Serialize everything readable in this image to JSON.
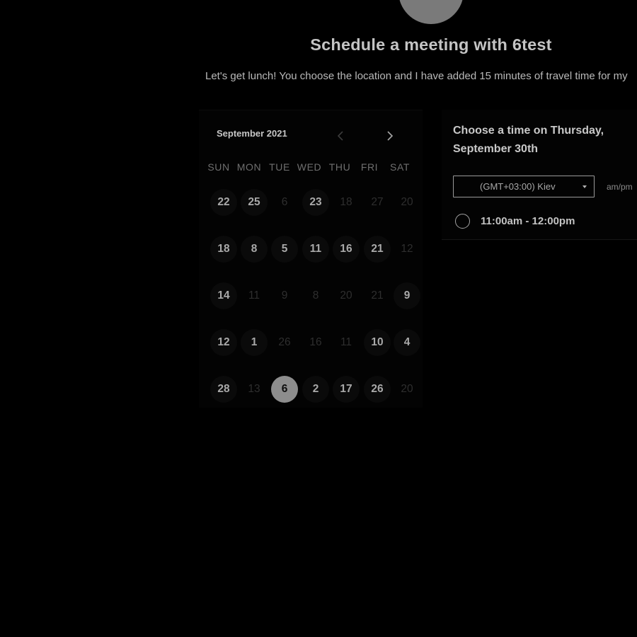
{
  "header": {
    "title": "Schedule a meeting with 6test",
    "description": "Let's get lunch! You choose the location and I have added 15 minutes of travel time for my"
  },
  "calendar": {
    "month_label": "September 2021",
    "prev_icon": "chevron-left-icon",
    "next_icon": "chevron-right-icon",
    "weekdays": [
      "SUN",
      "MON",
      "TUE",
      "WED",
      "THU",
      "FRI",
      "SAT"
    ],
    "weeks": [
      [
        {
          "label": "22",
          "state": "available"
        },
        {
          "label": "25",
          "state": "available"
        },
        {
          "label": "6",
          "state": "unavailable"
        },
        {
          "label": "23",
          "state": "available"
        },
        {
          "label": "18",
          "state": "unavailable"
        },
        {
          "label": "27",
          "state": "unavailable"
        },
        {
          "label": "20",
          "state": "unavailable"
        }
      ],
      [
        {
          "label": "18",
          "state": "available"
        },
        {
          "label": "8",
          "state": "available"
        },
        {
          "label": "5",
          "state": "available"
        },
        {
          "label": "11",
          "state": "available"
        },
        {
          "label": "16",
          "state": "available"
        },
        {
          "label": "21",
          "state": "available"
        },
        {
          "label": "12",
          "state": "unavailable"
        }
      ],
      [
        {
          "label": "14",
          "state": "available"
        },
        {
          "label": "11",
          "state": "unavailable"
        },
        {
          "label": "9",
          "state": "unavailable"
        },
        {
          "label": "8",
          "state": "unavailable"
        },
        {
          "label": "20",
          "state": "unavailable"
        },
        {
          "label": "21",
          "state": "unavailable"
        },
        {
          "label": "9",
          "state": "available"
        }
      ],
      [
        {
          "label": "12",
          "state": "available"
        },
        {
          "label": "1",
          "state": "available"
        },
        {
          "label": "26",
          "state": "unavailable"
        },
        {
          "label": "16",
          "state": "unavailable"
        },
        {
          "label": "11",
          "state": "unavailable"
        },
        {
          "label": "10",
          "state": "available"
        },
        {
          "label": "4",
          "state": "available"
        }
      ],
      [
        {
          "label": "28",
          "state": "available"
        },
        {
          "label": "13",
          "state": "unavailable"
        },
        {
          "label": "6",
          "state": "selected"
        },
        {
          "label": "2",
          "state": "available"
        },
        {
          "label": "17",
          "state": "available"
        },
        {
          "label": "26",
          "state": "available"
        },
        {
          "label": "20",
          "state": "unavailable"
        }
      ]
    ]
  },
  "time_panel": {
    "heading": "Choose a time on Thursday, September 30th",
    "timezone_value": "(GMT+03:00) Kiev",
    "ampm_label": "am/pm",
    "slots": [
      {
        "label": "11:00am - 12:00pm"
      }
    ]
  },
  "colors": {
    "background": "#000000",
    "text_primary": "#c4c4c4",
    "selected_day": "#8d8d8d"
  }
}
